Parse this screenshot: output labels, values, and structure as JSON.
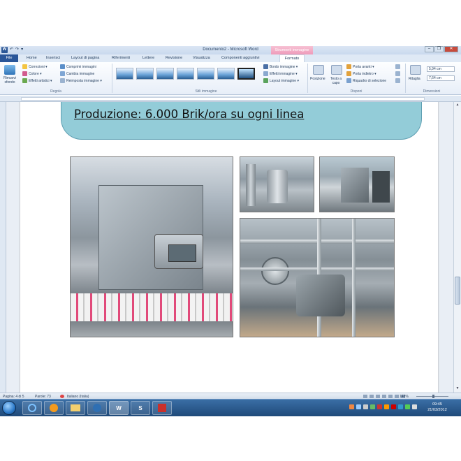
{
  "window": {
    "title": "Documento2 - Microsoft Word",
    "context_tab": "Strumenti immagine",
    "controls": [
      "–",
      "❐",
      "✕"
    ]
  },
  "quick_access": [
    "W",
    "↶",
    "↷",
    "▾"
  ],
  "tabs": {
    "file": "File",
    "items": [
      "Home",
      "Inserisci",
      "Layout di pagina",
      "Riferimenti",
      "Lettere",
      "Revisione",
      "Visualizza",
      "Componenti aggiuntivi"
    ],
    "active": "Formato"
  },
  "ribbon": {
    "remove_bg": "Rimuovi sfondo",
    "adjust": {
      "corrections": "Correzioni ▾",
      "color": "Colore ▾",
      "effects": "Effetti artistici ▾",
      "compress": "Comprimi immagini",
      "change": "Cambia immagine",
      "reset": "Reimposta immagine ▾",
      "label": "Regola"
    },
    "styles": {
      "label": "Stili immagine",
      "border": "Bordo immagine ▾",
      "effects": "Effetti immagine ▾",
      "layout": "Layout immagine ▾"
    },
    "arrange": {
      "position": "Posizione",
      "wrap": "Testo a capo",
      "forward": "Porta avanti ▾",
      "backward": "Porta indietro ▾",
      "selection": "Riquadro di selezione",
      "label": "Disponi"
    },
    "size": {
      "crop": "Ritaglia",
      "height": "5,94 cm",
      "width": "7,64 cm",
      "label": "Dimensioni"
    }
  },
  "document": {
    "title": "Produzione: 6.000 Brik/ora su ogni linea"
  },
  "status": {
    "page": "Pagina: 4 di 5",
    "words": "Parole: 73",
    "language": "Italiano (Italia)",
    "zoom": "148%"
  },
  "taskbar": {
    "word_label": "W",
    "skype_label": "S",
    "clock_time": "09:45",
    "clock_date": "21/03/2012"
  },
  "colors": {
    "ribbon_accent": "#2a5699",
    "banner": "#93ccd8",
    "taskbar": "#2b5a8e"
  }
}
